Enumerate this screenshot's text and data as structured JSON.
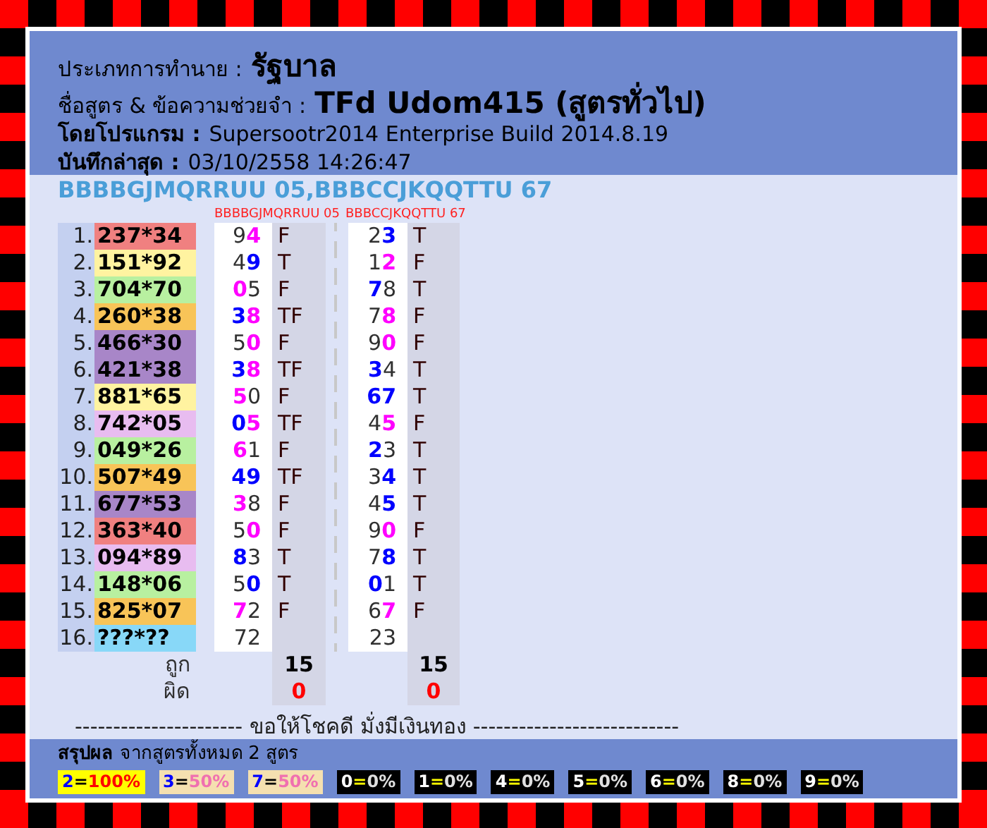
{
  "header": {
    "type_label": "ประเภทการทำนาย :",
    "type_value": "รัฐบาล",
    "formula_label": "ชื่อสูตร & ข้อความช่วยจำ :",
    "formula_value": "TFd Udom415 (สูตรทั่วไป)",
    "program_label": "โดยโปรแกรม :",
    "program_value": "Supersootr2014 Enterprise Build 2014.8.19",
    "saved_label": "บันทึกล่าสุด :",
    "saved_value": "03/10/2558 14:26:47"
  },
  "formula_title": "BBBBGJMQRRUU 05,BBBCCJKQQTTU 67",
  "columns": [
    "BBBBGJMQRRUU 05",
    "BBBCCJKQQTTU 67"
  ],
  "rows": [
    {
      "no": "1.",
      "draw": "237*34",
      "color": "#f08080",
      "cells": [
        {
          "digits": [
            {
              "d": "9",
              "kind": "plain"
            },
            {
              "d": "4",
              "kind": "pink"
            }
          ],
          "result": "F"
        },
        {
          "digits": [
            {
              "d": "2",
              "kind": "plain"
            },
            {
              "d": "3",
              "kind": "blue"
            }
          ],
          "result": "T"
        }
      ]
    },
    {
      "no": "2.",
      "draw": "151*92",
      "color": "#fff3a0",
      "cells": [
        {
          "digits": [
            {
              "d": "4",
              "kind": "plain"
            },
            {
              "d": "9",
              "kind": "blue"
            }
          ],
          "result": "T"
        },
        {
          "digits": [
            {
              "d": "1",
              "kind": "plain"
            },
            {
              "d": "2",
              "kind": "pink"
            }
          ],
          "result": "F"
        }
      ]
    },
    {
      "no": "3.",
      "draw": "704*70",
      "color": "#b8f0a0",
      "cells": [
        {
          "digits": [
            {
              "d": "0",
              "kind": "pink"
            },
            {
              "d": "5",
              "kind": "plain"
            }
          ],
          "result": "F"
        },
        {
          "digits": [
            {
              "d": "7",
              "kind": "blue"
            },
            {
              "d": "8",
              "kind": "plain"
            }
          ],
          "result": "T"
        }
      ]
    },
    {
      "no": "4.",
      "draw": "260*38",
      "color": "#f8c458",
      "cells": [
        {
          "digits": [
            {
              "d": "3",
              "kind": "blue"
            },
            {
              "d": "8",
              "kind": "pink"
            }
          ],
          "result": "TF"
        },
        {
          "digits": [
            {
              "d": "7",
              "kind": "plain"
            },
            {
              "d": "8",
              "kind": "pink"
            }
          ],
          "result": "F"
        }
      ]
    },
    {
      "no": "5.",
      "draw": "466*30",
      "color": "#a886c8",
      "cells": [
        {
          "digits": [
            {
              "d": "5",
              "kind": "plain"
            },
            {
              "d": "0",
              "kind": "pink"
            }
          ],
          "result": "F"
        },
        {
          "digits": [
            {
              "d": "9",
              "kind": "plain"
            },
            {
              "d": "0",
              "kind": "pink"
            }
          ],
          "result": "F"
        }
      ]
    },
    {
      "no": "6.",
      "draw": "421*38",
      "color": "#a886c8",
      "cells": [
        {
          "digits": [
            {
              "d": "3",
              "kind": "blue"
            },
            {
              "d": "8",
              "kind": "pink"
            }
          ],
          "result": "TF"
        },
        {
          "digits": [
            {
              "d": "3",
              "kind": "blue"
            },
            {
              "d": "4",
              "kind": "plain"
            }
          ],
          "result": "T"
        }
      ]
    },
    {
      "no": "7.",
      "draw": "881*65",
      "color": "#fff3a0",
      "cells": [
        {
          "digits": [
            {
              "d": "5",
              "kind": "pink"
            },
            {
              "d": "0",
              "kind": "plain"
            }
          ],
          "result": "F"
        },
        {
          "digits": [
            {
              "d": "6",
              "kind": "blue"
            },
            {
              "d": "7",
              "kind": "blue"
            }
          ],
          "result": "T"
        }
      ]
    },
    {
      "no": "8.",
      "draw": "742*05",
      "color": "#e8bcf0",
      "cells": [
        {
          "digits": [
            {
              "d": "0",
              "kind": "blue"
            },
            {
              "d": "5",
              "kind": "pink"
            }
          ],
          "result": "TF"
        },
        {
          "digits": [
            {
              "d": "4",
              "kind": "plain"
            },
            {
              "d": "5",
              "kind": "pink"
            }
          ],
          "result": "F"
        }
      ]
    },
    {
      "no": "9.",
      "draw": "049*26",
      "color": "#b8f0a0",
      "cells": [
        {
          "digits": [
            {
              "d": "6",
              "kind": "pink"
            },
            {
              "d": "1",
              "kind": "plain"
            }
          ],
          "result": "F"
        },
        {
          "digits": [
            {
              "d": "2",
              "kind": "blue"
            },
            {
              "d": "3",
              "kind": "plain"
            }
          ],
          "result": "T"
        }
      ]
    },
    {
      "no": "10.",
      "draw": "507*49",
      "color": "#f8c458",
      "cells": [
        {
          "digits": [
            {
              "d": "4",
              "kind": "blue"
            },
            {
              "d": "9",
              "kind": "blue"
            }
          ],
          "result": "TF"
        },
        {
          "digits": [
            {
              "d": "3",
              "kind": "plain"
            },
            {
              "d": "4",
              "kind": "blue"
            }
          ],
          "result": "T"
        }
      ]
    },
    {
      "no": "11.",
      "draw": "677*53",
      "color": "#a886c8",
      "cells": [
        {
          "digits": [
            {
              "d": "3",
              "kind": "pink"
            },
            {
              "d": "8",
              "kind": "plain"
            }
          ],
          "result": "F"
        },
        {
          "digits": [
            {
              "d": "4",
              "kind": "plain"
            },
            {
              "d": "5",
              "kind": "blue"
            }
          ],
          "result": "T"
        }
      ]
    },
    {
      "no": "12.",
      "draw": "363*40",
      "color": "#f08080",
      "cells": [
        {
          "digits": [
            {
              "d": "5",
              "kind": "plain"
            },
            {
              "d": "0",
              "kind": "pink"
            }
          ],
          "result": "F"
        },
        {
          "digits": [
            {
              "d": "9",
              "kind": "plain"
            },
            {
              "d": "0",
              "kind": "pink"
            }
          ],
          "result": "F"
        }
      ]
    },
    {
      "no": "13.",
      "draw": "094*89",
      "color": "#e8bcf0",
      "cells": [
        {
          "digits": [
            {
              "d": "8",
              "kind": "blue"
            },
            {
              "d": "3",
              "kind": "plain"
            }
          ],
          "result": "T"
        },
        {
          "digits": [
            {
              "d": "7",
              "kind": "plain"
            },
            {
              "d": "8",
              "kind": "blue"
            }
          ],
          "result": "T"
        }
      ]
    },
    {
      "no": "14.",
      "draw": "148*06",
      "color": "#b8f0a0",
      "cells": [
        {
          "digits": [
            {
              "d": "5",
              "kind": "plain"
            },
            {
              "d": "0",
              "kind": "blue"
            }
          ],
          "result": "T"
        },
        {
          "digits": [
            {
              "d": "0",
              "kind": "blue"
            },
            {
              "d": "1",
              "kind": "plain"
            }
          ],
          "result": "T"
        }
      ]
    },
    {
      "no": "15.",
      "draw": "825*07",
      "color": "#f8c458",
      "cells": [
        {
          "digits": [
            {
              "d": "7",
              "kind": "pink"
            },
            {
              "d": "2",
              "kind": "plain"
            }
          ],
          "result": "F"
        },
        {
          "digits": [
            {
              "d": "6",
              "kind": "plain"
            },
            {
              "d": "7",
              "kind": "pink"
            }
          ],
          "result": "F"
        }
      ]
    },
    {
      "no": "16.",
      "draw": "???*??",
      "color": "#88d8f8",
      "cells": [
        {
          "digits": [
            {
              "d": "7",
              "kind": "plain"
            },
            {
              "d": "2",
              "kind": "plain"
            }
          ]
        },
        {
          "digits": [
            {
              "d": "2",
              "kind": "plain"
            },
            {
              "d": "3",
              "kind": "plain"
            }
          ]
        }
      ]
    }
  ],
  "totals": [
    {
      "label": "ถูก",
      "kind": "right",
      "values": [
        "15",
        "15"
      ]
    },
    {
      "label": "ผิด",
      "kind": "wrong",
      "values": [
        "0",
        "0"
      ]
    }
  ],
  "footer_line": "---------------------- ขอให้โชคดี มั่งมีเงินทอง ---------------------------",
  "summary": {
    "title": "สรุปผล",
    "subtitle": "จากสูตรทั้งหมด 2 สูตร",
    "badges": [
      {
        "digit": "2",
        "sep": "=",
        "percent": "100%",
        "kind": "hit"
      },
      {
        "digit": "3",
        "sep": "=",
        "percent": "50%",
        "kind": "half"
      },
      {
        "digit": "7",
        "sep": "=",
        "percent": "50%",
        "kind": "half"
      },
      {
        "digit": "0",
        "sep": "=",
        "percent": "0%",
        "kind": "miss"
      },
      {
        "digit": "1",
        "sep": "=",
        "percent": "0%",
        "kind": "miss"
      },
      {
        "digit": "4",
        "sep": "=",
        "percent": "0%",
        "kind": "miss"
      },
      {
        "digit": "5",
        "sep": "=",
        "percent": "0%",
        "kind": "miss"
      },
      {
        "digit": "6",
        "sep": "=",
        "percent": "0%",
        "kind": "miss"
      },
      {
        "digit": "8",
        "sep": "=",
        "percent": "0%",
        "kind": "miss"
      },
      {
        "digit": "9",
        "sep": "=",
        "percent": "0%",
        "kind": "miss"
      }
    ]
  }
}
